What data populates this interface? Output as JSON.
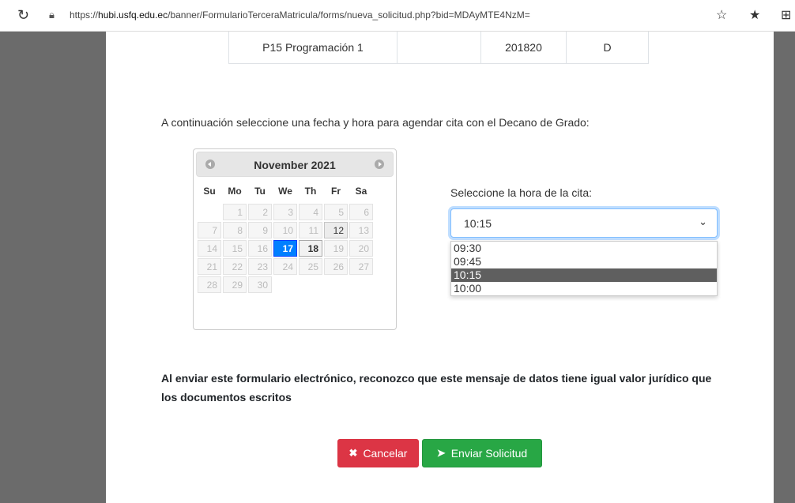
{
  "browser": {
    "url_prefix": "https://",
    "url_host": "hubi.usfq.edu.ec",
    "url_path": "/banner/FormularioTerceraMatricula/forms/nueva_solicitud.php?bid=MDAyMTE4NzM=",
    "icons": [
      "refresh-icon",
      "lock-icon",
      "favorite-add-icon",
      "favorites-icon",
      "collections-icon"
    ]
  },
  "course_row": [
    "P15 Programación 1",
    "",
    "201820",
    "D"
  ],
  "instruction": "A continuación seleccione una fecha y hora para agendar cita con el Decano de Grado:",
  "calendar": {
    "title": "November 2021",
    "weekdays": [
      "Su",
      "Mo",
      "Tu",
      "We",
      "Th",
      "Fr",
      "Sa"
    ],
    "weeks": [
      [
        "",
        "1",
        "2",
        "3",
        "4",
        "5",
        "6"
      ],
      [
        "7",
        "8",
        "9",
        "10",
        "11",
        "12",
        "13"
      ],
      [
        "14",
        "15",
        "16",
        "17",
        "18",
        "19",
        "20"
      ],
      [
        "21",
        "22",
        "23",
        "24",
        "25",
        "26",
        "27"
      ],
      [
        "28",
        "29",
        "30",
        "",
        "",
        "",
        ""
      ]
    ],
    "selected_day": "17",
    "today": "18",
    "available_days": [
      "12",
      "18"
    ]
  },
  "time": {
    "label": "Seleccione la hora de la cita:",
    "selected": "10:15",
    "options": [
      "09:30",
      "09:45",
      "10:15",
      "10:00"
    ]
  },
  "legal_text": "Al enviar este formulario electrónico, reconozco que este mensaje de datos tiene igual valor jurídico que los documentos escritos",
  "buttons": {
    "cancel": "Cancelar",
    "submit": "Enviar Solicitud"
  },
  "colors": {
    "cancel": "#dc3545",
    "submit": "#28a745",
    "selected_day": "#007fff",
    "active_option": "#5f5f5f"
  }
}
